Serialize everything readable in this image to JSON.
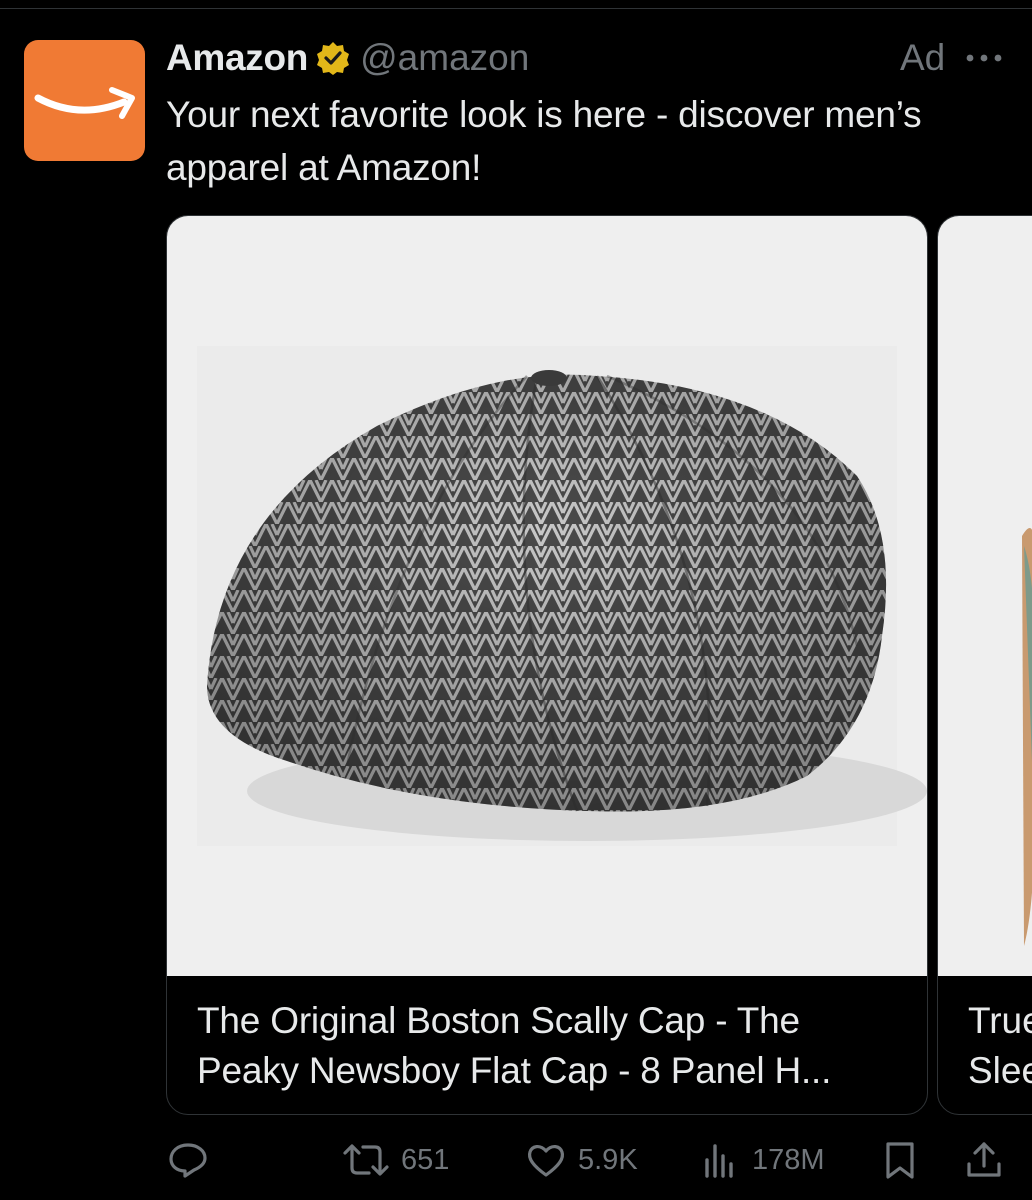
{
  "tweet": {
    "display_name": "Amazon",
    "handle": "@amazon",
    "ad_label": "Ad",
    "text": "Your next favorite look is here - discover men’s apparel at Amazon!"
  },
  "cards": [
    {
      "caption": "The Original Boston Scally Cap - The Peaky Newsboy Flat Cap - 8 Panel H..."
    },
    {
      "caption_line1": "True",
      "caption_line2": "Slee"
    }
  ],
  "actions": {
    "replies": "",
    "retweets": "651",
    "likes": "5.9K",
    "views": "178M"
  },
  "icons": {
    "avatar": "amazon-smile-logo",
    "verified": "verified-badge-icon",
    "more": "more-dots-icon",
    "reply": "reply-icon",
    "retweet": "retweet-icon",
    "like": "heart-icon",
    "views": "views-chart-icon",
    "bookmark": "bookmark-icon",
    "share": "share-icon"
  },
  "colors": {
    "background": "#000000",
    "brand_orange": "#f07a34",
    "verified_gold": "#e2b719",
    "text_primary": "#e7e9ea",
    "text_secondary": "#71767b"
  }
}
